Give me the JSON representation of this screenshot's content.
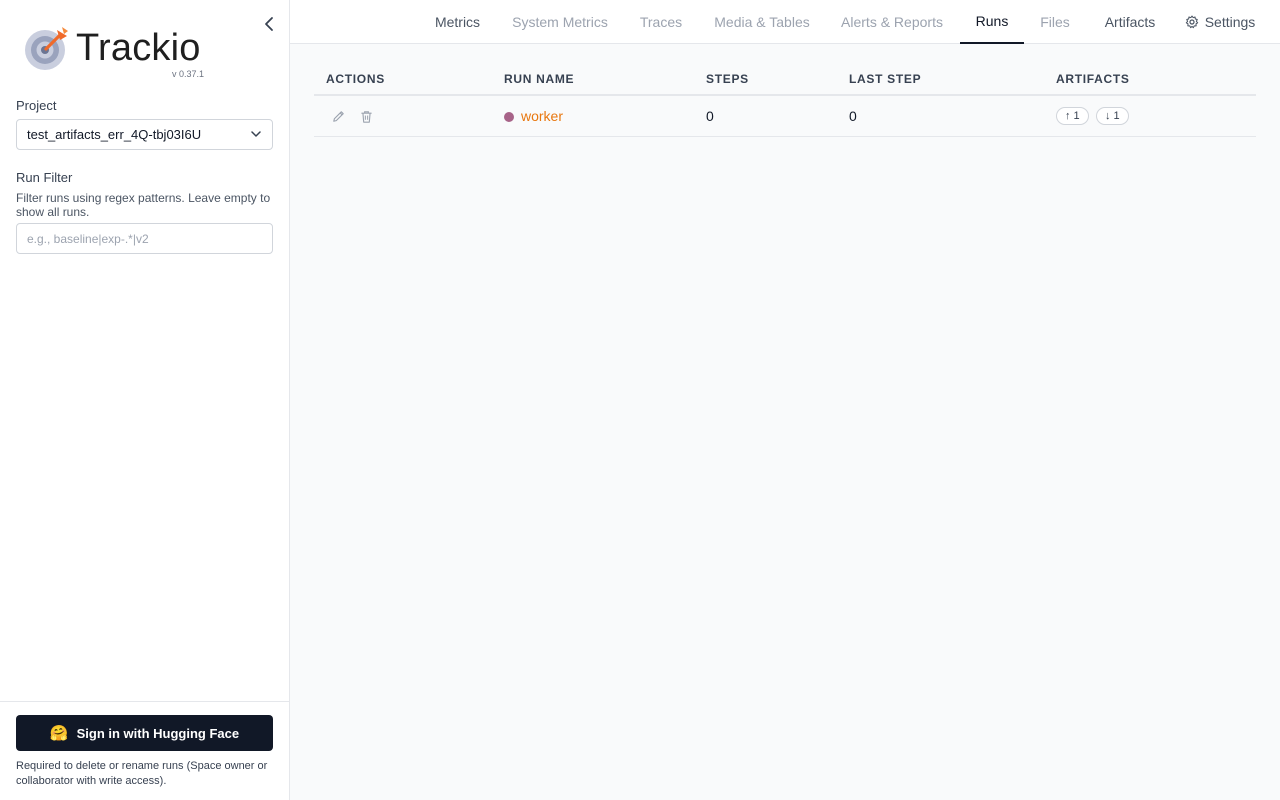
{
  "app": {
    "name": "Trackio",
    "version": "v 0.37.1"
  },
  "sidebar": {
    "project_label": "Project",
    "project_value": "test_artifacts_err_4Q-tbj03I6U",
    "filter_label": "Run Filter",
    "filter_help": "Filter runs using regex patterns. Leave empty to show all runs.",
    "filter_placeholder": "e.g., baseline|exp-.*|v2",
    "signin_label": "Sign in with Hugging Face",
    "signin_emoji": "🤗",
    "signin_note": "Required to delete or rename runs (Space owner or collaborator with write access)."
  },
  "nav": {
    "tabs": [
      {
        "label": "Metrics",
        "state": "normal"
      },
      {
        "label": "System Metrics",
        "state": "dim"
      },
      {
        "label": "Traces",
        "state": "dim"
      },
      {
        "label": "Media & Tables",
        "state": "dim"
      },
      {
        "label": "Alerts & Reports",
        "state": "dim"
      },
      {
        "label": "Runs",
        "state": "active"
      },
      {
        "label": "Files",
        "state": "dim"
      },
      {
        "label": "Artifacts",
        "state": "normal"
      },
      {
        "label": "Settings",
        "state": "normal",
        "icon": "gear-icon"
      }
    ]
  },
  "table": {
    "columns": [
      "ACTIONS",
      "RUN NAME",
      "STEPS",
      "LAST STEP",
      "ARTIFACTS"
    ],
    "rows": [
      {
        "run_name": "worker",
        "run_color": "#a76388",
        "steps": "0",
        "last_step": "0",
        "artifacts_up": "↑ 1",
        "artifacts_down": "↓ 1"
      }
    ]
  },
  "colors": {
    "accent": "#e8770f",
    "signin_bg": "#111827"
  }
}
